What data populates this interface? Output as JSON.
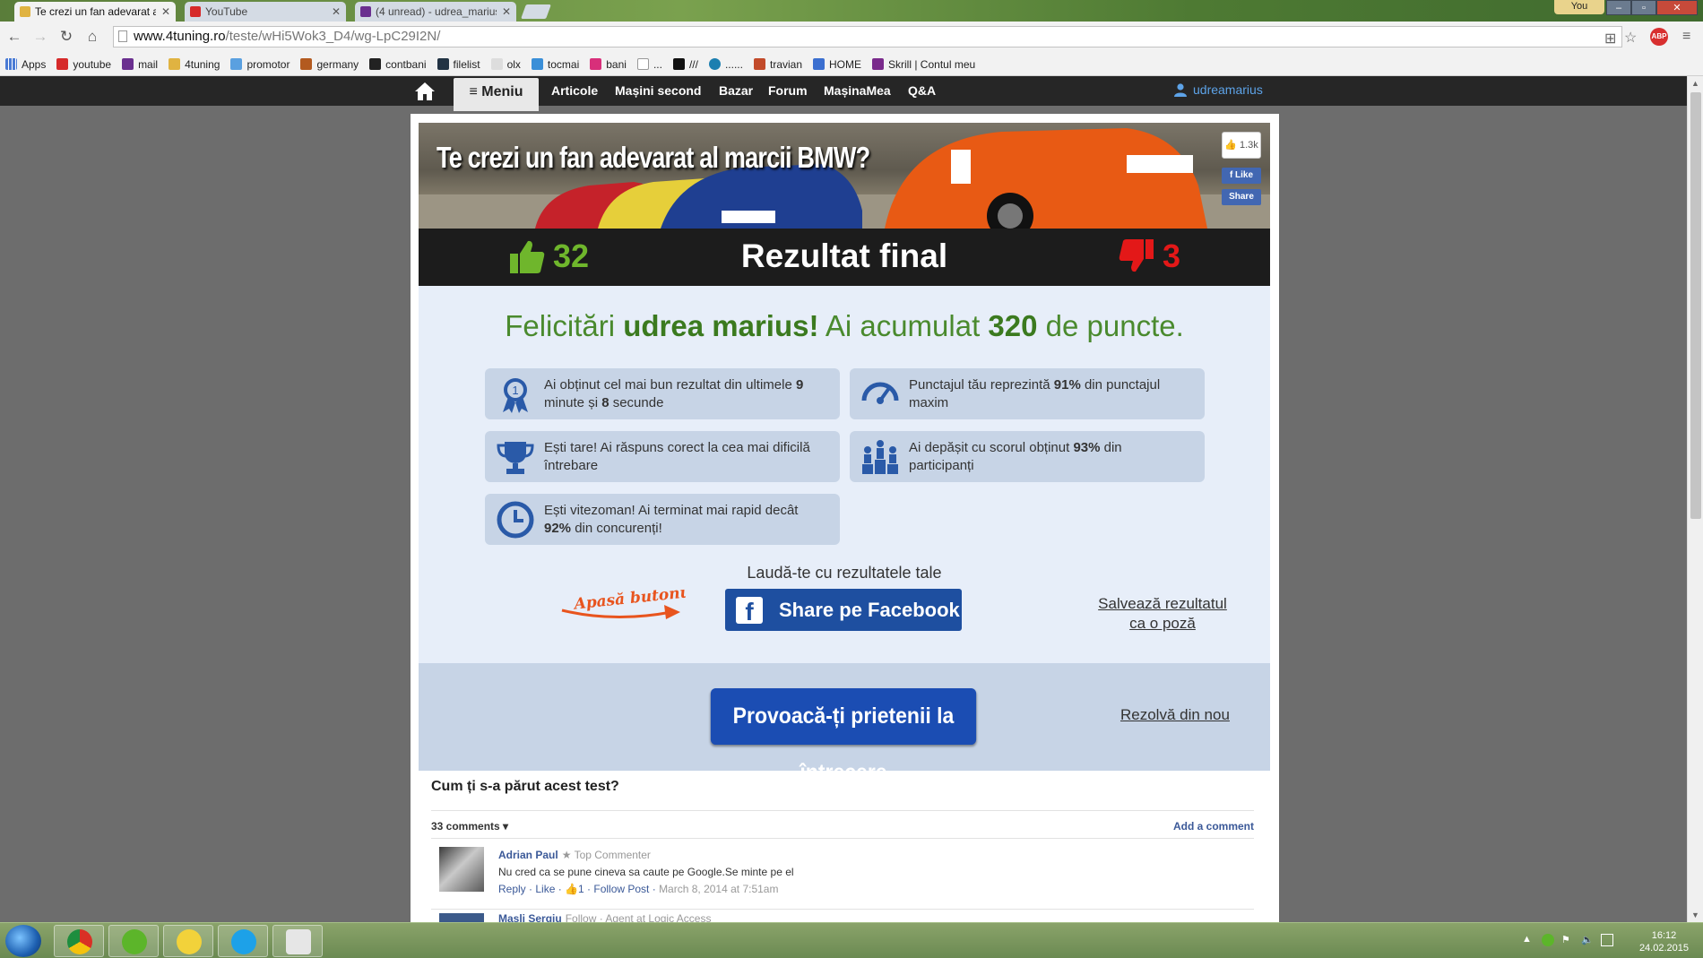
{
  "browser": {
    "tabs": [
      {
        "title": "Te crezi un fan adevarat al",
        "active": true
      },
      {
        "title": "YouTube",
        "active": false
      },
      {
        "title": "(4 unread) - udrea_marius",
        "active": false
      }
    ],
    "profile_label": "You",
    "address": {
      "host": "www.4tuning.ro",
      "path": "/teste/wHi5Wok3_D4/wg-LpC29I2N/"
    },
    "bookmarks": [
      "Apps",
      "youtube",
      "mail",
      "4tuning",
      "promotor",
      "germany",
      "contbani",
      "filelist",
      "olx",
      "tocmai",
      "bani",
      "...",
      "///",
      "......",
      "travian",
      "HOME",
      "Skrill | Contul meu"
    ]
  },
  "site_nav": {
    "menu_label": "≡ Meniu",
    "links": [
      "Articole",
      "Mașini second",
      "Bazar",
      "Forum",
      "MașinaMea",
      "Q&A"
    ],
    "user": "udreamarius"
  },
  "quiz": {
    "banner_title": "Te crezi un fan adevarat al marcii BMW?",
    "like_count": "1.3k",
    "fb_like": "Like",
    "fb_share": "Share",
    "result_title": "Rezultat final",
    "correct": "32",
    "wrong": "3",
    "congrats": {
      "prefix": "Felicitări ",
      "name": "udrea marius!",
      "middle": " Ai acumulat ",
      "points": "320",
      "suffix": " de puncte."
    },
    "cards": [
      {
        "icon": "ribbon-medal-icon",
        "text_a": "Ai obținut cel mai bun rezultat din ultimele ",
        "b1": "9",
        "text_b": " minute și ",
        "b2": "8",
        "text_c": " secunde"
      },
      {
        "icon": "speedometer-icon",
        "text_a": "Punctajul tău reprezintă ",
        "b1": "91%",
        "text_b": " din punctajul maxim"
      },
      {
        "icon": "trophy-icon",
        "text_a": "Ești tare! Ai răspuns corect la cea mai dificilă întrebare"
      },
      {
        "icon": "podium-people-icon",
        "text_a": "Ai depășit cu scorul obținut ",
        "b1": "93%",
        "text_b": " din participanți"
      },
      {
        "icon": "clock-icon",
        "text_a": "Ești vitezoman! Ai terminat mai rapid decât ",
        "b1": "92%",
        "text_b": " din concurenți!"
      }
    ],
    "brag_label": "Laudă-te cu rezultatele tale",
    "arrow_hint": "Apasă butonul!",
    "share_button": "Share pe Facebook",
    "save_link": "Salvează rezultatul ca o poză",
    "challenge_button": "Provoacă-ți prietenii la întrecere",
    "redo_link": "Rezolvă din nou"
  },
  "comments": {
    "question": "Cum ți s-a părut acest test?",
    "count_label": "33 comments",
    "add_label": "Add a comment",
    "items": [
      {
        "author": "Adrian Paul",
        "badge": "★ Top Commenter",
        "text": "Nu cred ca se pune cineva sa caute pe Google.Se minte pe el",
        "reply": "Reply",
        "like": "Like",
        "likes": "1",
        "follow": "Follow Post",
        "date": "March 8, 2014 at 7:51am"
      },
      {
        "author": "Masli Sergiu",
        "badge": "Follow · Agent at Logic Access"
      }
    ]
  },
  "taskbar": {
    "time": "16:12",
    "date": "24.02.2015"
  }
}
